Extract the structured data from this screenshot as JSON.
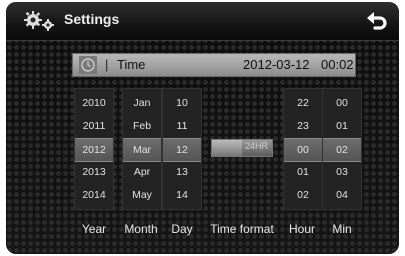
{
  "header": {
    "title": "Settings",
    "settings_icon": "gear-pair-icon",
    "back_icon": "back-arrow-icon"
  },
  "time_bar": {
    "label": "Time",
    "separator": "|",
    "date": "2012-03-12",
    "time": "00:02",
    "icon": "clock-icon"
  },
  "columns": {
    "year": {
      "label": "Year",
      "values": [
        "2010",
        "2011",
        "2012",
        "2013",
        "2014"
      ],
      "selected_index": 2
    },
    "month": {
      "label": "Month",
      "values": [
        "Jan",
        "Feb",
        "Mar",
        "Apr",
        "May"
      ],
      "selected_index": 2
    },
    "day": {
      "label": "Day",
      "values": [
        "10",
        "11",
        "12",
        "13",
        "14"
      ],
      "selected_index": 2
    },
    "hour": {
      "label": "Hour",
      "values": [
        "22",
        "23",
        "00",
        "01",
        "02"
      ],
      "selected_index": 2
    },
    "min": {
      "label": "Min",
      "values": [
        "00",
        "01",
        "02",
        "03",
        "04"
      ],
      "selected_index": 2
    }
  },
  "time_format": {
    "label": "Time format",
    "value": "24HR"
  },
  "colors": {
    "screen_bg": "#111111",
    "bar_bg": "#a5a5a5",
    "selected": "#5e5e5e"
  }
}
